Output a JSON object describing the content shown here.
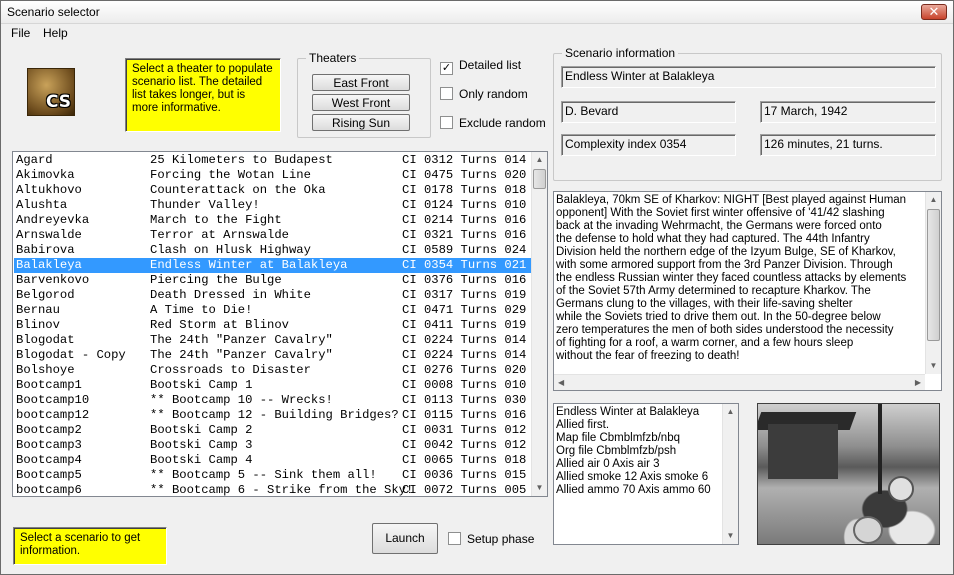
{
  "window": {
    "title": "Scenario selector",
    "close_glyph": "✕"
  },
  "menu": {
    "file_label": "File",
    "help_label": "Help"
  },
  "logo": {
    "text": "CS"
  },
  "help_top": "Select a theater to populate scenario list. The detailed list takes longer, but is more informative.",
  "help_bottom": "Select a scenario to get information.",
  "theaters": {
    "legend": "Theaters",
    "buttons": [
      "East Front",
      "West Front",
      "Rising Sun"
    ]
  },
  "options": {
    "detailed_list": {
      "label": "Detailed list",
      "checked": true
    },
    "only_random": {
      "label": "Only random",
      "checked": false
    },
    "exclude_random": {
      "label": "Exclude random",
      "checked": false
    }
  },
  "scenario_info": {
    "legend": "Scenario information",
    "name": "Endless Winter at Balakleya",
    "author": "D. Bevard",
    "date": "17 March, 1942",
    "complexity": "Complexity index 0354",
    "duration": "126 minutes, 21 turns."
  },
  "scenarios": [
    {
      "location": "Agard",
      "title": "25 Kilometers to Budapest",
      "info": "CI 0312 Turns 014"
    },
    {
      "location": "Akimovka",
      "title": "Forcing the Wotan Line",
      "info": "CI 0475 Turns 020"
    },
    {
      "location": "Altukhovo",
      "title": "Counterattack on the Oka",
      "info": "CI 0178 Turns 018"
    },
    {
      "location": "Alushta",
      "title": "Thunder Valley!",
      "info": "CI 0124 Turns 010"
    },
    {
      "location": "Andreyevka",
      "title": "March to the Fight",
      "info": "CI 0214 Turns 016"
    },
    {
      "location": "Arnswalde",
      "title": "Terror at Arnswalde",
      "info": "CI 0321 Turns 016"
    },
    {
      "location": "Babirova",
      "title": "Clash on Hlusk Highway",
      "info": "CI 0589 Turns 024"
    },
    {
      "location": "Balakleya",
      "title": "Endless Winter at Balakleya",
      "info": "CI 0354 Turns 021",
      "selected": true
    },
    {
      "location": "Barvenkovo",
      "title": "Piercing the Bulge",
      "info": "CI 0376 Turns 016"
    },
    {
      "location": "Belgorod",
      "title": "Death Dressed in White",
      "info": "CI 0317 Turns 019"
    },
    {
      "location": "Bernau",
      "title": "A Time to Die!",
      "info": "CI 0471 Turns 029"
    },
    {
      "location": "Blinov",
      "title": "Red Storm at Blinov",
      "info": "CI 0411 Turns 019"
    },
    {
      "location": "Blogodat",
      "title": "The 24th \"Panzer Cavalry\"",
      "info": "CI 0224 Turns 014"
    },
    {
      "location": "Blogodat - Copy",
      "title": "The 24th \"Panzer Cavalry\"",
      "info": "CI 0224 Turns 014"
    },
    {
      "location": "Bolshoye",
      "title": "Crossroads to Disaster",
      "info": "CI 0276 Turns 020"
    },
    {
      "location": "Bootcamp1",
      "title": "Bootski Camp 1",
      "info": "CI 0008 Turns 010"
    },
    {
      "location": "Bootcamp10",
      "title": "** Bootcamp 10 -- Wrecks!",
      "info": "CI 0113 Turns 030"
    },
    {
      "location": "bootcamp12",
      "title": "** Bootcamp 12 - Building Bridges?",
      "info": "CI 0115 Turns 016"
    },
    {
      "location": "Bootcamp2",
      "title": "Bootski Camp 2",
      "info": "CI 0031 Turns 012"
    },
    {
      "location": "Bootcamp3",
      "title": "Bootski Camp 3",
      "info": "CI 0042 Turns 012"
    },
    {
      "location": "Bootcamp4",
      "title": "Bootski Camp 4",
      "info": "CI 0065 Turns 018"
    },
    {
      "location": "Bootcamp5",
      "title": "** Bootcamp 5 -- Sink them all!",
      "info": "CI 0036 Turns 015"
    },
    {
      "location": "bootcamp6",
      "title": "** Bootcamp 6 - Strike from the Sky!",
      "info": "CI 0072 Turns 005"
    }
  ],
  "description": [
    "Balakleya, 70km SE of Kharkov: NIGHT [Best played against Human",
    "opponent] With the Soviet first winter offensive of '41/42 slashing",
    "back at the invading Wehrmacht, the Germans were forced onto",
    "the defense to hold what they had captured. The 44th Infantry",
    "Division held the northern edge of the Izyum Bulge, SE of Kharkov,",
    "with some armored support from the 3rd Panzer Division. Through",
    "the endless Russian winter they faced countless attacks by elements",
    "of the Soviet 57th Army determined to recapture Kharkov. The",
    "Germans clung to the villages, with their life-saving shelter",
    "while the Soviets tried to drive them out. In the 50-degree below",
    "zero temperatures the men of both sides understood the necessity",
    "of fighting for a roof, a warm corner, and a few hours sleep",
    "without the fear of freezing to death!"
  ],
  "details": [
    "Endless Winter at Balakleya",
    "Allied first.",
    "Map file Cbmblmfzb/nbq",
    "Org file Cbmblmfzb/psh",
    "Allied air 0 Axis air 3",
    "Allied smoke 12 Axis smoke 6",
    "Allied ammo 70 Axis ammo 60"
  ],
  "launch_label": "Launch",
  "setup_phase": {
    "label": "Setup phase",
    "checked": false
  },
  "icons": {
    "up": "▲",
    "down": "▼",
    "left": "◀",
    "right": "▶",
    "grip": "≡",
    "check": "✓"
  }
}
